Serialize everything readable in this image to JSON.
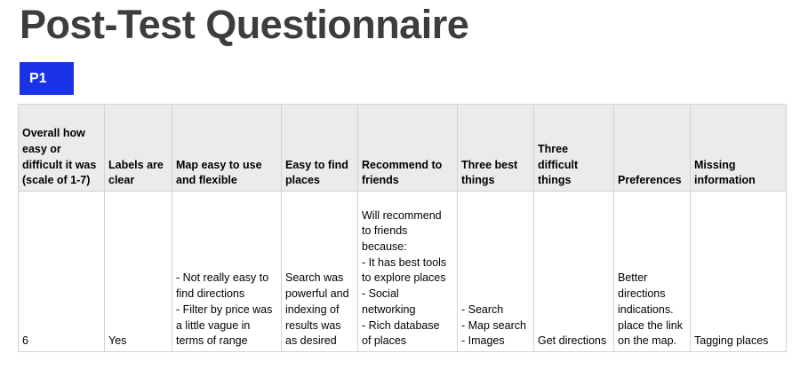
{
  "title": "Post-Test Questionnaire",
  "participant_badge": {
    "label": "P1",
    "color": "#1a33e6"
  },
  "table": {
    "headers": [
      [
        "Overall how",
        "easy or",
        "difficult it was",
        "(scale of 1-7)"
      ],
      [
        "Labels are",
        "clear"
      ],
      [
        "Map easy to use",
        "and flexible"
      ],
      [
        "Easy to find",
        "places"
      ],
      [
        "Recommend to",
        "friends"
      ],
      [
        "Three best",
        "things"
      ],
      [
        "Three",
        "difficult",
        "things"
      ],
      [
        "Preferences"
      ],
      [
        "Missing",
        "information"
      ]
    ],
    "row": [
      [
        "6"
      ],
      [
        "Yes"
      ],
      [
        "- Not really easy to",
        "find directions",
        "- Filter by price was",
        "a little vague in",
        "terms of range"
      ],
      [
        "Search was",
        "powerful and",
        "indexing of",
        "results was",
        "as desired"
      ],
      [
        "Will recommend",
        "to friends",
        "because:",
        "- It has best tools",
        "to explore places",
        "- Social",
        "networking",
        "- Rich database",
        "of places"
      ],
      [
        "- Search",
        "- Map search",
        "- Images"
      ],
      [
        "Get directions"
      ],
      [
        "Better",
        "directions",
        "indications.",
        "place the link",
        "on the map."
      ],
      [
        "Tagging places"
      ]
    ]
  }
}
